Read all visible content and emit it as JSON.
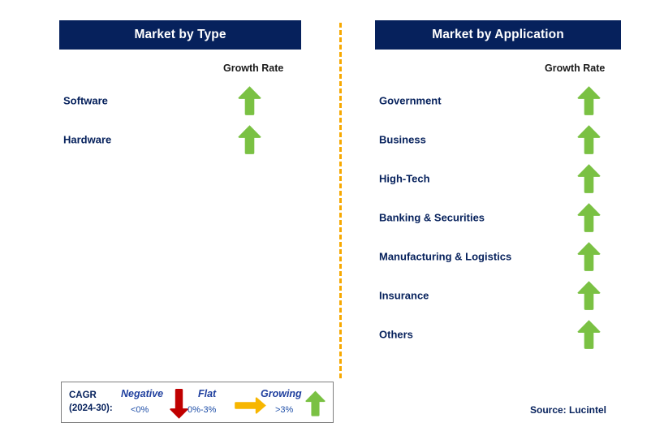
{
  "columns": [
    {
      "id": "market-by-type",
      "title": "Market by Type",
      "growth_caption": "Growth Rate",
      "rows": [
        {
          "label": "Software",
          "growth": "Growing",
          "icon": "arrow-up-green"
        },
        {
          "label": "Hardware",
          "growth": "Growing",
          "icon": "arrow-up-green"
        }
      ]
    },
    {
      "id": "market-by-application",
      "title": "Market by Application",
      "growth_caption": "Growth Rate",
      "rows": [
        {
          "label": "Government",
          "growth": "Growing",
          "icon": "arrow-up-green"
        },
        {
          "label": "Business",
          "growth": "Growing",
          "icon": "arrow-up-green"
        },
        {
          "label": "High-Tech",
          "growth": "Growing",
          "icon": "arrow-up-green"
        },
        {
          "label": "Banking & Securities",
          "growth": "Growing",
          "icon": "arrow-up-green"
        },
        {
          "label": "Manufacturing & Logistics",
          "growth": "Growing",
          "icon": "arrow-up-green"
        },
        {
          "label": "Insurance",
          "growth": "Growing",
          "icon": "arrow-up-green"
        },
        {
          "label": "Others",
          "growth": "Growing",
          "icon": "arrow-up-green"
        }
      ]
    }
  ],
  "legend": {
    "cagr_line1": "CAGR",
    "cagr_line2": "(2024-30):",
    "entries": [
      {
        "term": "Negative",
        "range": "<0%",
        "icon": "arrow-down-red"
      },
      {
        "term": "Flat",
        "range": "0%-3%",
        "icon": "arrow-right-orange"
      },
      {
        "term": "Growing",
        "range": ">3%",
        "icon": "arrow-up-green"
      }
    ]
  },
  "source": "Source: Lucintel",
  "colors": {
    "header_bg": "#06215c",
    "header_text": "#ffffff",
    "label_text": "#06215c",
    "growth_up": "#7ac143",
    "growth_down": "#c00000",
    "growth_flat": "#f7b600",
    "divider": "#f7a800",
    "legend_border": "#7f7f7f",
    "legend_term": "#1f3f9e",
    "legend_range": "#1f4fa8",
    "background": "#ffffff"
  }
}
